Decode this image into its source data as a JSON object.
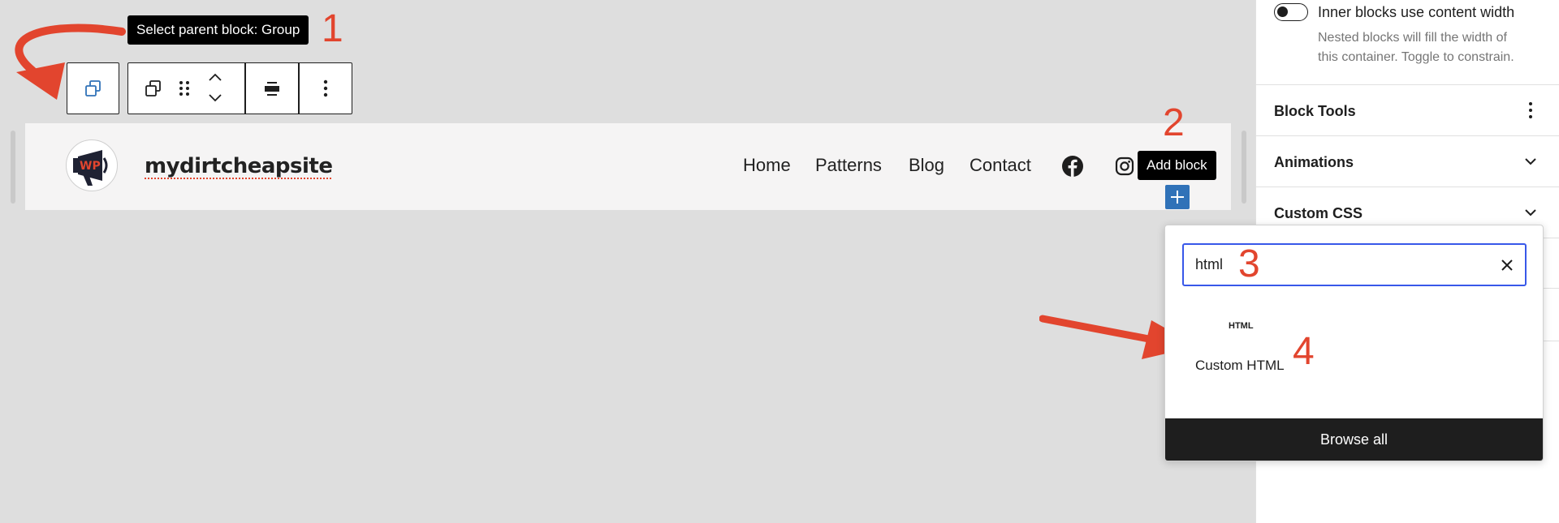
{
  "tooltips": {
    "select_parent": "Select parent block: Group",
    "add_block": "Add block"
  },
  "annotations": [
    "1",
    "2",
    "3",
    "4"
  ],
  "header": {
    "site_title": "mydirtcheapsite",
    "logo_text": "WP",
    "nav": [
      "Home",
      "Patterns",
      "Blog",
      "Contact"
    ],
    "social": [
      "facebook-icon",
      "instagram-icon"
    ]
  },
  "sidebar": {
    "toggle_label": "Inner blocks use content width",
    "toggle_help": [
      "Nested blocks will fill the width of",
      "this container. Toggle to constrain."
    ],
    "sections": [
      "Block Tools",
      "Animations",
      "Custom CSS"
    ]
  },
  "inserter": {
    "search_value": "html",
    "result_icon_text": "HTML",
    "result_label": "Custom HTML",
    "browse_all": "Browse all"
  },
  "colors": {
    "accent": "#3858e9",
    "annotation": "#e2452e",
    "add_button": "#3072b8"
  }
}
